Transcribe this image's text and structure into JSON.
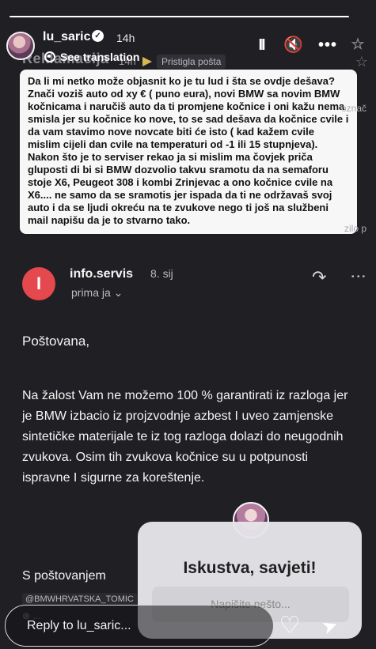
{
  "ghost_header": {
    "title": "Reklamacija",
    "time": "14h",
    "tag": "Pristigla pošta",
    "star": "☆"
  },
  "story_header": {
    "username": "lu_saric",
    "verified_symbol": "✓",
    "time": "14h",
    "translate": "See translation"
  },
  "controls": {
    "pause": "II",
    "mute": "🔇",
    "more": "•••",
    "star": "☆"
  },
  "note_text": "Da li mi netko može objasnit ko je tu lud i šta se ovdje dešava? Znači voziš auto od xy € ( puno eura), novi BMW sa novim BMW kočnicama i naručiš auto da ti promjene kočnice i oni kažu nema smisla jer su kočnice ko nove, to se sad dešava da kočnice cvile i da vam stavimo nove novcate biti će isto ( kad kažem cvile mislim cijeli dan cvile na temperaturi od -1 ili 15 stupnjeva). Nakon što je to serviser rekao ja si mislim ma čovjek priča gluposti di bi si BMW dozvolio takvu sramotu da na semaforu stoje X6, Peugeot 308 i kombi Zrinjevac a ono kočnice cvile na X6.... ne samo da se sramotis jer ispada da ti ne održavaš svoj auto i da se ljudi okreću na te zvukove nego ti još na službeni mail napišu da je to stvarno tako.",
  "faint_labels": {
    "right_1": "označ",
    "right_2": "zilo p"
  },
  "email": {
    "sender_initial": "I",
    "sender": "info.servis",
    "date": "8. sij",
    "received": "prima ja ⌄",
    "reply_icon": "↶",
    "more_icon": "⋮",
    "greeting": "Poštovana,",
    "body": "Na žalost Vam ne možemo 100 % garantirati iz razloga jer je BMW izbacio iz projzvodnje azbest I uveo zamjenske sintetičke materijale te iz tog razloga dolazi do neugodnih zvukova. Osim tih zvukova kočnice su u potpunosti ispravne I sigurne za koreštenje.",
    "signature": "S poštovanjem",
    "signature_tag": "@BMWHRVATSKA_TOMIC",
    "signature_mini": "⊗ ..."
  },
  "question_box": {
    "title": "Iskustva, savjeti!",
    "placeholder": "Napišite nešto..."
  },
  "reply_bar": {
    "placeholder": "Reply to lu_saric...",
    "heart": "♡",
    "send": "➤"
  }
}
